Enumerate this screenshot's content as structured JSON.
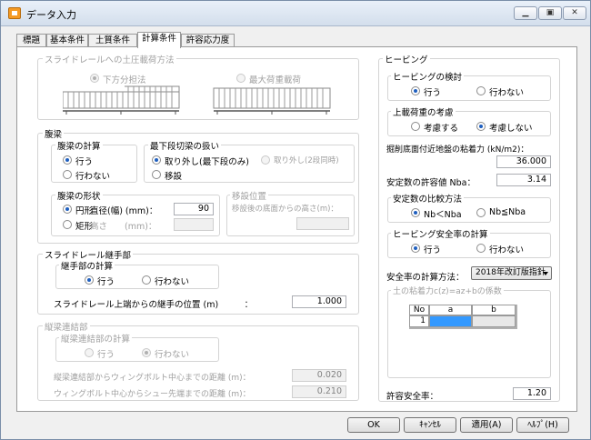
{
  "window": {
    "title": "データ入力"
  },
  "tabs": [
    "標題",
    "基本条件",
    "土質条件",
    "計算条件",
    "許容応力度"
  ],
  "slide_load": {
    "title": "スライドレールへの土圧載荷方法",
    "opt_lower": "下方分担法",
    "opt_max": "最大荷重載荷"
  },
  "beam": {
    "title": "腹梁",
    "calc": {
      "title": "腹梁の計算",
      "yes": "行う",
      "no": "行わない"
    },
    "lowest": {
      "title": "最下段切梁の扱い",
      "opt1": "取り外し(最下段のみ)",
      "opt2": "取り外し(2段同時)",
      "opt3": "移設"
    },
    "shape": {
      "title": "腹梁の形状",
      "round": "円形",
      "diameter_label": "直径(幅) (mm)：",
      "diameter_value": "90",
      "rect": "矩形",
      "height_label": "高さ　　(mm)："
    },
    "move": {
      "title": "移設位置",
      "label": "移設後の底面からの高さ(m)："
    }
  },
  "joint": {
    "title": "スライドレール継手部",
    "calc_title": "継手部の計算",
    "yes": "行う",
    "no": "行わない",
    "pos_label": "スライドレール上端からの継手の位置 (m)　　　：",
    "pos_value": "1.000"
  },
  "longitudinal": {
    "title": "縦梁連結部",
    "calc_title": "縦梁連結部の計算",
    "yes": "行う",
    "no": "行わない",
    "dist1_label": "縦梁連結部からウィングボルト中心までの距離 (m)：",
    "dist1_value": "0.020",
    "dist2_label": "ウィングボルト中心からシュー先端までの距離 (m)：",
    "dist2_value": "0.210"
  },
  "heaving": {
    "title": "ヒービング",
    "check": {
      "title": "ヒービングの検討",
      "yes": "行う",
      "no": "行わない"
    },
    "load": {
      "title": "上載荷重の考慮",
      "yes": "考慮する",
      "no": "考慮しない"
    },
    "cohesion_label": "掘削底面付近地盤の粘着力 (kN/m2)：",
    "cohesion_value": "36.000",
    "nba_label": "安定数の許容値 Nba：",
    "nba_value": "3.14",
    "compare": {
      "title": "安定数の比較方法",
      "opt1": "Nb＜Nba",
      "opt2": "Nb≦Nba"
    },
    "safety": {
      "title": "ヒービング安全率の計算",
      "yes": "行う",
      "no": "行わない"
    },
    "method_label": "安全率の計算方法：",
    "method_value": "2018年改訂版指針",
    "coef_title": "土の粘着力c(z)=az+bの係数",
    "grid": {
      "headers": [
        "No",
        "a",
        "b"
      ],
      "row": "1"
    },
    "allow_label": "許容安全率：",
    "allow_value": "1.20"
  },
  "buttons": {
    "ok": "OK",
    "cancel": "ｷｬﾝｾﾙ",
    "apply": "適用(A)",
    "help": "ﾍﾙﾌﾟ(H)"
  }
}
